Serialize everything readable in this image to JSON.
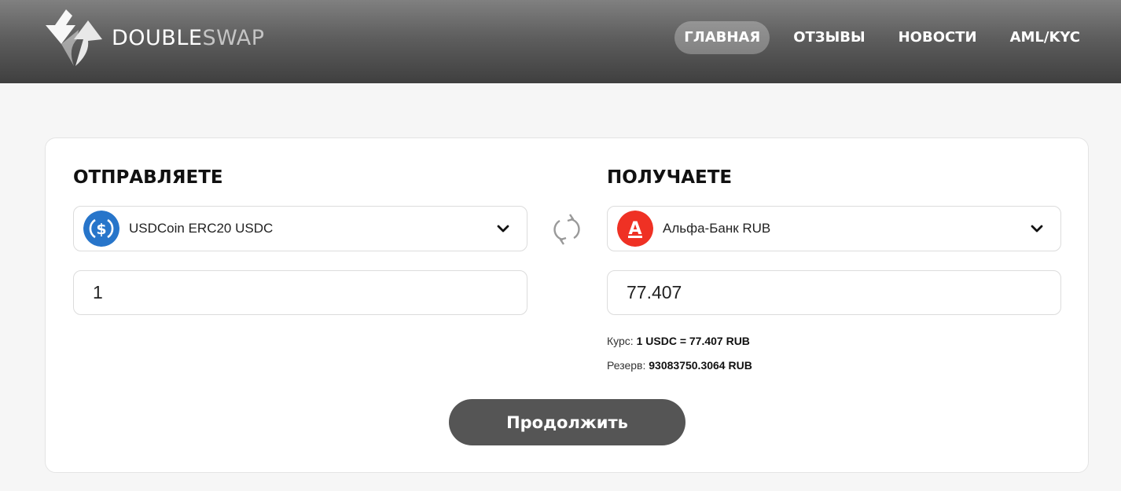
{
  "header": {
    "logo_part1": "DOUBLE",
    "logo_part2": "SWAP",
    "nav": [
      {
        "label": "ГЛАВНАЯ",
        "active": true
      },
      {
        "label": "ОТЗЫВЫ",
        "active": false
      },
      {
        "label": "НОВОСТИ",
        "active": false
      },
      {
        "label": "AML/KYC",
        "active": false
      }
    ]
  },
  "exchange": {
    "send": {
      "title": "ОТПРАВЛЯЕТЕ",
      "currency": "USDCoin ERC20 USDC",
      "icon": "usdc-icon",
      "amount": "1"
    },
    "receive": {
      "title": "ПОЛУЧАЕТЕ",
      "currency": "Альфа-Банк RUB",
      "icon": "alfa-bank-icon",
      "amount": "77.407"
    },
    "rate_label": "Курс: ",
    "rate_value": "1 USDC = 77.407 RUB",
    "reserve_label": "Резерв: ",
    "reserve_value": "93083750.3064 RUB",
    "submit_label": "Продолжить"
  },
  "colors": {
    "usdc": "#2775ca",
    "alfa": "#ef3124",
    "button": "#555555"
  }
}
